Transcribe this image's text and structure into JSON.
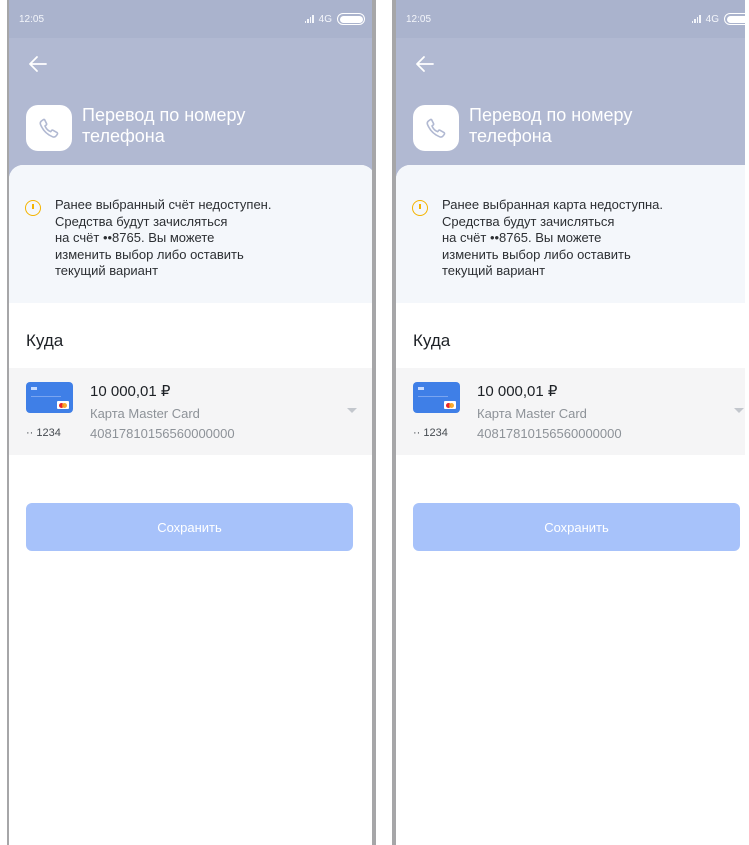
{
  "screens": [
    {
      "status": {
        "time": "12:05",
        "network": "4G"
      },
      "header": {
        "title": "Перевод по номеру телефона",
        "app_icon": "phone-icon",
        "back_icon": "arrow-left-icon"
      },
      "notice": {
        "icon": "warning-circle-icon",
        "text": "Ранее выбранный счёт недоступен.\nСредства будут зачисляться\nна счёт  ••8765. Вы можете\nизменить выбор либо оставить\nтекущий вариант"
      },
      "destination": {
        "title": "Куда",
        "account": {
          "amount": "10 000,01 ₽",
          "name": "Карта Master Card",
          "number": "40817810156560000000",
          "mask": "·· 1234"
        }
      },
      "save_label": "Сохранить"
    },
    {
      "status": {
        "time": "12:05",
        "network": "4G"
      },
      "header": {
        "title": "Перевод по номеру телефона",
        "app_icon": "phone-icon",
        "back_icon": "arrow-left-icon"
      },
      "notice": {
        "icon": "warning-circle-icon",
        "text": "Ранее выбранная карта недоступна.\nСредства будут зачисляться\nна счёт  ••8765. Вы можете\nизменить выбор либо оставить\nтекущий вариант"
      },
      "destination": {
        "title": "Куда",
        "account": {
          "amount": "10 000,01 ₽",
          "name": "Карта Master Card",
          "number": "40817810156560000000",
          "mask": "·· 1234"
        }
      },
      "save_label": "Сохранить"
    }
  ],
  "colors": {
    "header": "#b1b9d2",
    "status_bar": "#aab3cd",
    "button": "#a7c2fa",
    "card": "#3f7fe7",
    "warning": "#f4b400"
  }
}
